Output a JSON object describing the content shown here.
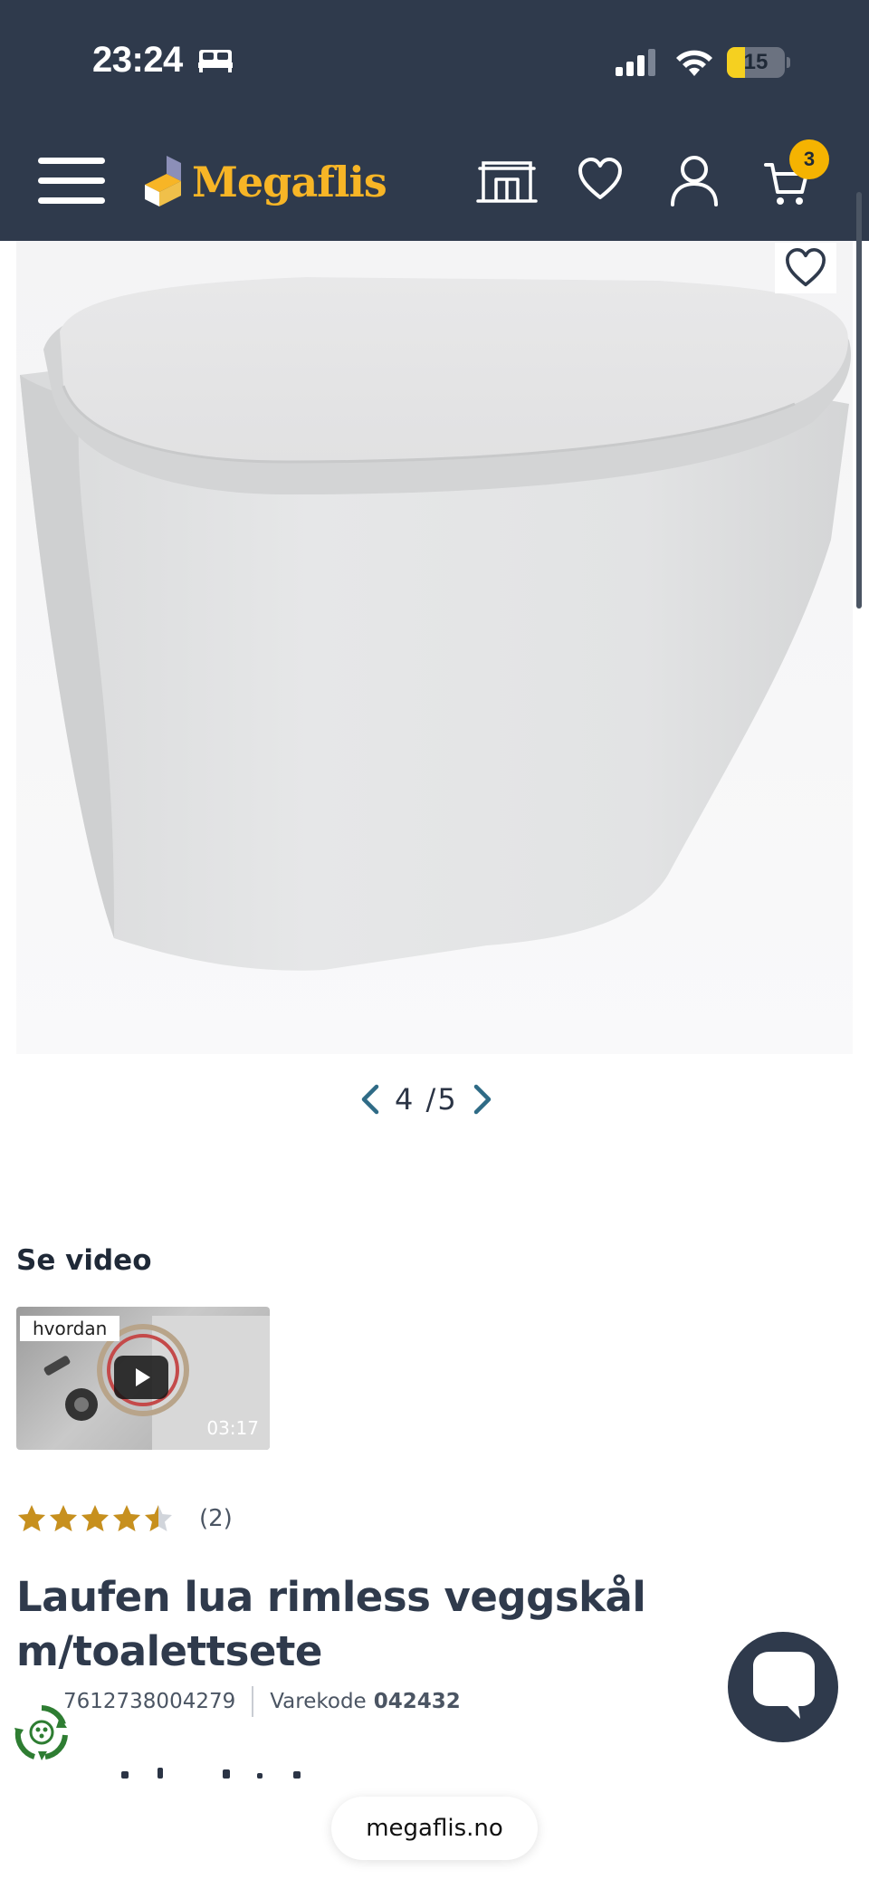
{
  "status_bar": {
    "time": "23:24",
    "battery_level": "15",
    "icons": [
      "bed-icon",
      "signal-icon",
      "wifi-icon",
      "battery-icon"
    ]
  },
  "header": {
    "logo_text": "Megaflis",
    "cart_count": "3",
    "colors": {
      "background": "#2f3a4c",
      "brand": "#f7b526",
      "badge": "#f5b301"
    },
    "icons": [
      "menu-icon",
      "store-icon",
      "heart-icon",
      "user-icon",
      "cart-icon"
    ]
  },
  "gallery": {
    "current": "4",
    "separator": "/",
    "total": "5",
    "icons": [
      "chevron-left-icon",
      "chevron-right-icon",
      "favorite-heart-icon"
    ]
  },
  "video": {
    "heading": "Se video",
    "tag": "hvordan",
    "duration": "03:17"
  },
  "rating": {
    "stars": 4.5,
    "max_stars": 5,
    "count": "(2)",
    "star_color": "#c7901e"
  },
  "product": {
    "title": "Laufen lua rimless veggskål m/toalettsete",
    "ean": "7612738004279",
    "code_label": "Varekode",
    "code_value": "042432"
  },
  "browser": {
    "url": "megaflis.no"
  }
}
